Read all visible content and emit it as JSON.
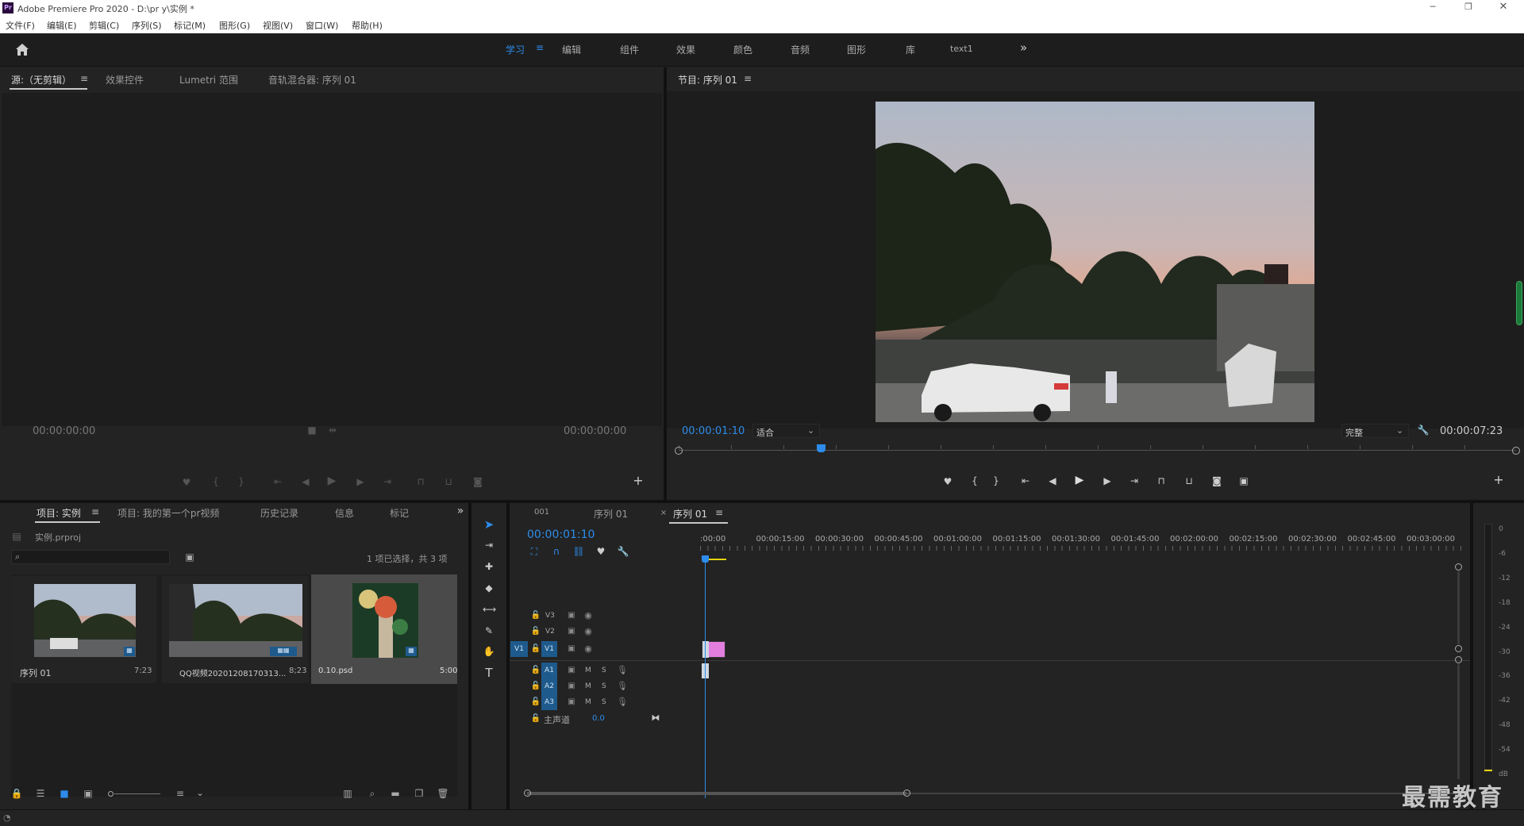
{
  "app": {
    "title": "Adobe Premiere Pro 2020 - D:\\pr y\\实例 *",
    "logo": "Pr"
  },
  "window_controls": [
    "minimize-icon",
    "restore-icon",
    "close-icon"
  ],
  "menu": [
    "文件(F)",
    "编辑(E)",
    "剪辑(C)",
    "序列(S)",
    "标记(M)",
    "图形(G)",
    "视图(V)",
    "窗口(W)",
    "帮助(H)"
  ],
  "workspaces": {
    "active": "学习",
    "items": [
      "学习",
      "编辑",
      "组件",
      "效果",
      "颜色",
      "音频",
      "图形",
      "库",
      "text1"
    ],
    "more": "»"
  },
  "source_panel": {
    "tabs": [
      "源:（无剪辑）",
      "效果控件",
      "Lumetri 范围",
      "音轨混合器: 序列 01"
    ],
    "tc_in": "00:00:00:00",
    "tc_out": "00:00:00:00"
  },
  "program_panel": {
    "title": "节目: 序列 01",
    "tc_current": "00:00:01:10",
    "fit": "适合",
    "quality": "完整",
    "tc_duration": "00:00:07:23",
    "playhead_fraction": 0.17
  },
  "project_panel": {
    "tabs": [
      "项目: 实例",
      "项目: 我的第一个pr视频",
      "历史记录",
      "信息",
      "标记"
    ],
    "project_file": "实例.prproj",
    "selection": "1 项已选择，共 3 项",
    "items": [
      {
        "name": "序列 01",
        "duration": "7:23"
      },
      {
        "name": "QQ视频20201208170313...",
        "duration": "8;23"
      },
      {
        "name": "0.10.psd",
        "duration": "5:00"
      }
    ]
  },
  "timeline": {
    "tabs": [
      "001",
      "序列 01",
      "序列 01"
    ],
    "active_tab": "序列 01",
    "tc": "00:00:01:10",
    "ruler": [
      ":00:00",
      "00:00:15:00",
      "00:00:30:00",
      "00:00:45:00",
      "00:01:00:00",
      "00:01:15:00",
      "00:01:30:00",
      "00:01:45:00",
      "00:02:00:00",
      "00:02:15:00",
      "00:02:30:00",
      "00:02:45:00",
      "00:03:00:00"
    ],
    "video_tracks": [
      "V3",
      "V2",
      "V1"
    ],
    "src_patch": "V1",
    "audio_tracks": [
      "A1",
      "A2",
      "A3"
    ],
    "m": "M",
    "s": "S",
    "master": "主声道",
    "master_val": "0.0"
  },
  "meter": {
    "scale": [
      "0",
      "-6",
      "-12",
      "-18",
      "-24",
      "-30",
      "-36",
      "-42",
      "-48",
      "-54",
      "dB"
    ]
  },
  "watermark": "最需教育",
  "colors": {
    "accent": "#2d8ceb",
    "clip": "#e27ede",
    "track_blue": "#1e5a8c"
  }
}
